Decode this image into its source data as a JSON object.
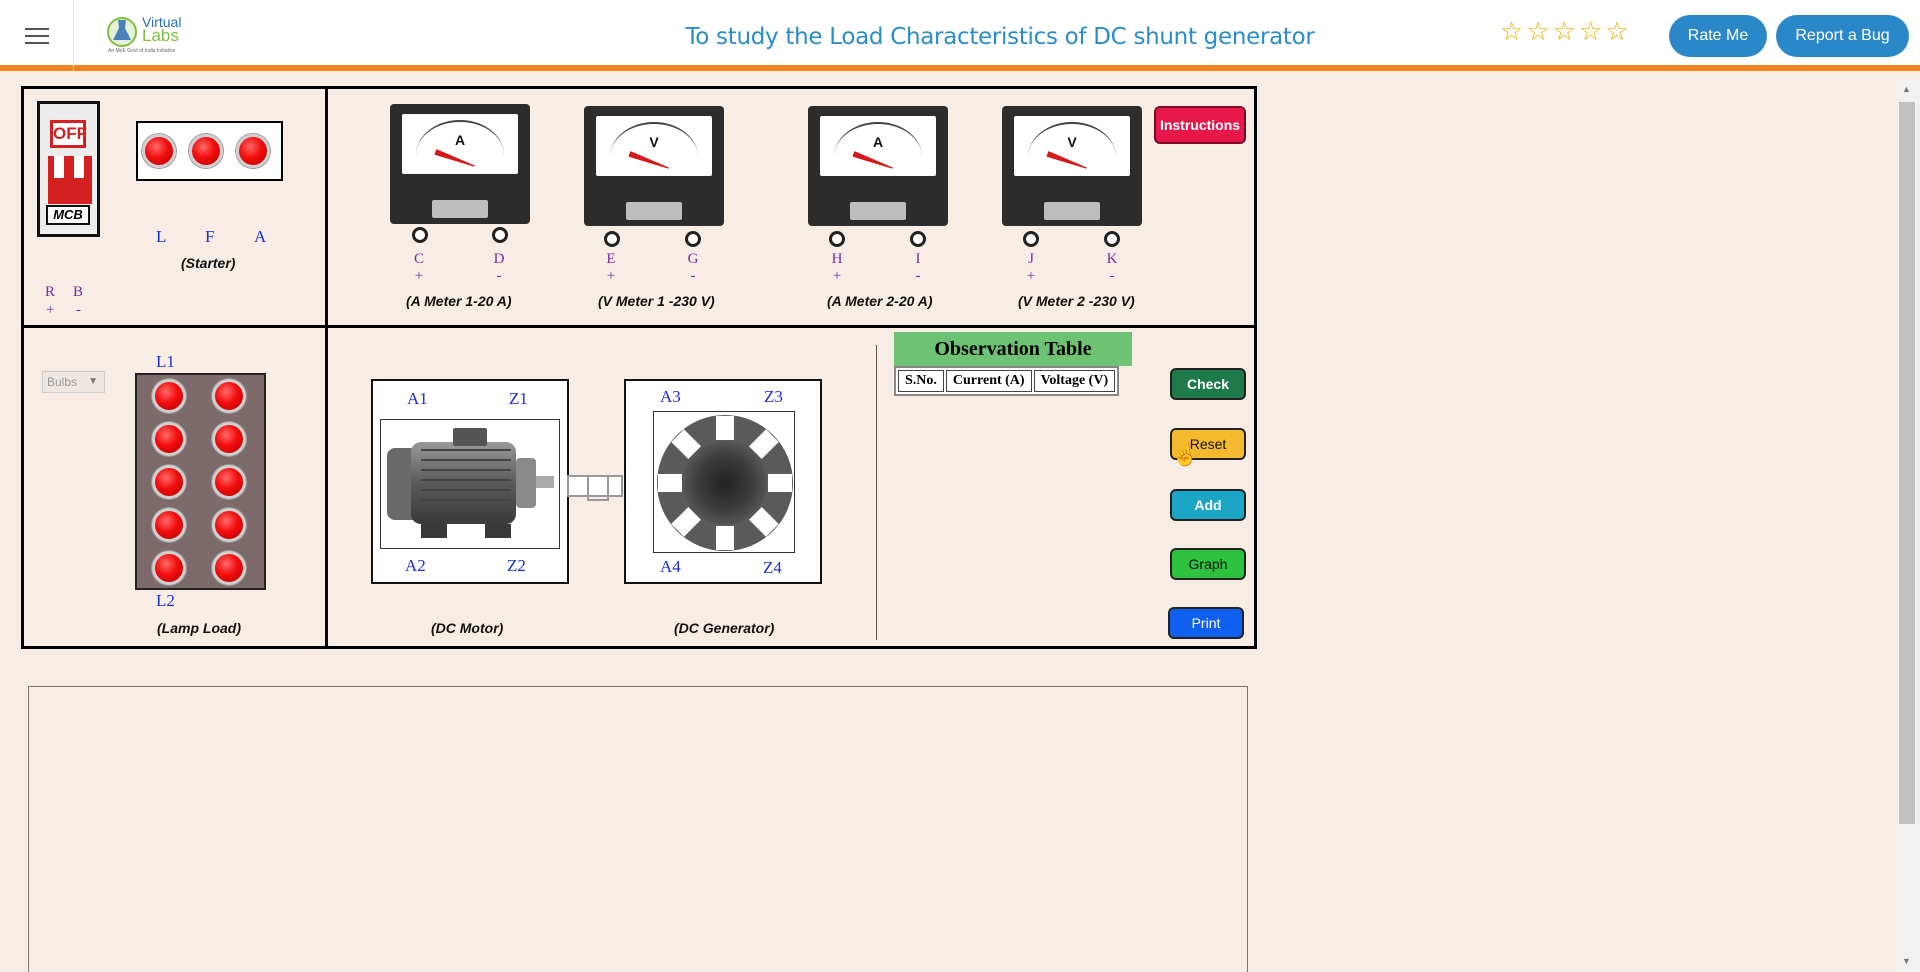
{
  "header": {
    "logo_text_1": "Virtual",
    "logo_text_2": "Labs",
    "logo_sub": "An MoE Govt of India Initiative",
    "title": "To study the Load Characteristics of DC shunt generator",
    "stars": [
      "☆",
      "☆",
      "☆",
      "☆",
      "☆"
    ],
    "rate_label": "Rate Me",
    "bug_label": "Report a Bug"
  },
  "mcb": {
    "state": "OFF",
    "label": "MCB"
  },
  "starter": {
    "terminals": [
      "L",
      "F",
      "A"
    ],
    "caption": "(Starter)",
    "supply_labels": [
      "R",
      "B"
    ],
    "supply_signs": [
      "+",
      "-"
    ]
  },
  "meters": [
    {
      "letter": "A",
      "terminals": [
        "C",
        "D"
      ],
      "signs": [
        "+",
        "-"
      ],
      "caption": "(A Meter 1-20 A)"
    },
    {
      "letter": "V",
      "terminals": [
        "E",
        "G"
      ],
      "signs": [
        "+",
        "-"
      ],
      "caption": "(V Meter 1 -230 V)"
    },
    {
      "letter": "A",
      "terminals": [
        "H",
        "I"
      ],
      "signs": [
        "+",
        "-"
      ],
      "caption": "(A Meter 2-20 A)"
    },
    {
      "letter": "V",
      "terminals": [
        "J",
        "K"
      ],
      "signs": [
        "+",
        "-"
      ],
      "caption": "(V Meter 2 -230 V)"
    }
  ],
  "instructions_label": "Instructions",
  "lamp": {
    "select_value": "Bulbs",
    "top_label": "L1",
    "bottom_label": "L2",
    "caption": "(Lamp Load)"
  },
  "motor": {
    "labels": [
      "A1",
      "Z1",
      "A2",
      "Z2"
    ],
    "caption": "(DC Motor)"
  },
  "generator": {
    "labels": [
      "A3",
      "Z3",
      "A4",
      "Z4"
    ],
    "caption": "(DC Generator)"
  },
  "observation": {
    "title": "Observation Table",
    "columns": [
      "S.No.",
      "Current (A)",
      "Voltage (V)"
    ]
  },
  "buttons": {
    "check": "Check",
    "reset": "Reset",
    "add": "Add",
    "graph": "Graph",
    "print": "Print"
  },
  "colors": {
    "accent_orange": "#f58220",
    "header_blue": "#2a88c9",
    "check": "#1e7a4a",
    "reset": "#f5b92e",
    "add": "#1aa6c4",
    "graph": "#2ec23e",
    "print": "#1060f0",
    "instructions": "#e8174a"
  }
}
